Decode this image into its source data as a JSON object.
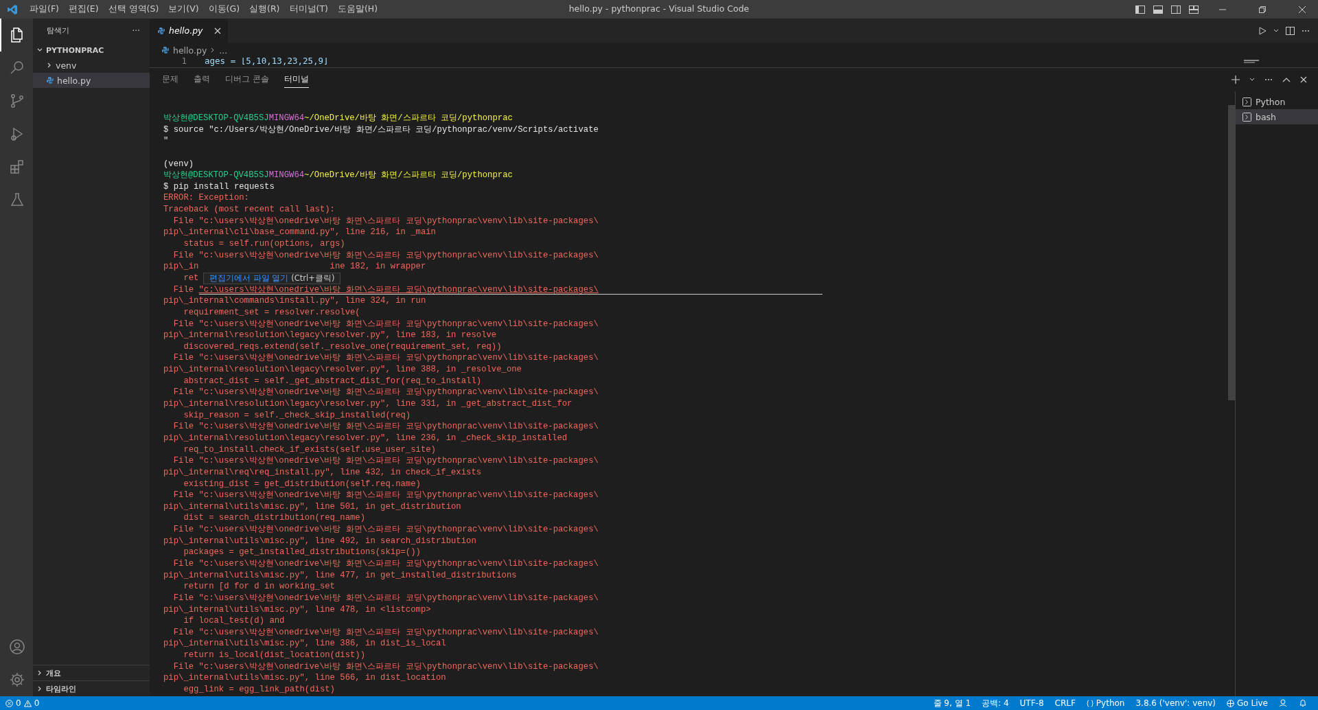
{
  "window": {
    "title": "hello.py - pythonprac - Visual Studio Code"
  },
  "menu": [
    "파일(F)",
    "편집(E)",
    "선택 영역(S)",
    "보기(V)",
    "이동(G)",
    "실행(R)",
    "터미널(T)",
    "도움말(H)"
  ],
  "activity_bar": [
    {
      "kind": "files",
      "selected": true
    },
    {
      "kind": "search",
      "selected": false
    },
    {
      "kind": "source-control",
      "selected": false
    },
    {
      "kind": "run",
      "selected": false
    },
    {
      "kind": "extensions",
      "selected": false
    },
    {
      "kind": "testing",
      "selected": false
    }
  ],
  "sidebar": {
    "title": "탐색기",
    "more": "···",
    "root": {
      "label": "PYTHONPRAC",
      "expanded": true,
      "children": [
        {
          "label": "venv",
          "kind": "folder",
          "expanded": false,
          "selected": false
        },
        {
          "label": "hello.py",
          "kind": "python",
          "selected": true
        }
      ]
    },
    "sections": [
      {
        "label": "개요",
        "expanded": false
      },
      {
        "label": "타임라인",
        "expanded": false
      }
    ]
  },
  "editor": {
    "tabs": [
      {
        "label": "hello.py",
        "selected": true
      }
    ],
    "breadcrumb": [
      "hello.py",
      "..."
    ],
    "lines": [
      {
        "number": "1",
        "code": "ages = [5,10,13,23,25,9]"
      }
    ]
  },
  "panel": {
    "tabs": [
      {
        "label": "문제",
        "selected": false
      },
      {
        "label": "출력",
        "selected": false
      },
      {
        "label": "디버그 콘솔",
        "selected": false
      },
      {
        "label": "터미널",
        "selected": true
      }
    ],
    "terminals": [
      {
        "label": "Python",
        "selected": false
      },
      {
        "label": "bash",
        "selected": true
      }
    ],
    "tooltip": {
      "text": "편집기에서 파일 열기",
      "shortcut": "(Ctrl+클릭)"
    },
    "lines": [
      {
        "kind": "prompt",
        "user": "박상현@DESKTOP-QV4B5SJ",
        "shell": "MINGW64",
        "path": "~/OneDrive/바탕 화면/스파르타 코딩/pythonprac"
      },
      {
        "kind": "command",
        "text": "$ source \"c:/Users/박상현/OneDrive/바탕 화면/스파르타 코딩/pythonprac/venv/Scripts/activate"
      },
      {
        "kind": "command",
        "text": "\""
      },
      {
        "kind": "blank"
      },
      {
        "kind": "command",
        "text": "(venv)"
      },
      {
        "kind": "prompt",
        "user": "박상현@DESKTOP-QV4B5SJ",
        "shell": "MINGW64",
        "path": "~/OneDrive/바탕 화면/스파르타 코딩/pythonprac"
      },
      {
        "kind": "command",
        "text": "$ pip install requests"
      },
      {
        "kind": "error",
        "text": "ERROR: Exception:"
      },
      {
        "kind": "error",
        "text": "Traceback (most recent call last):"
      },
      {
        "kind": "error",
        "text": "  File \"c:\\users\\박상현\\onedrive\\바탕 화면\\스파르타 코딩\\pythonprac\\venv\\lib\\site-packages\\"
      },
      {
        "kind": "error",
        "text": "pip\\_internal\\cli\\base_command.py\", line 216, in _main"
      },
      {
        "kind": "error",
        "text": "    status = self.run(options, args)"
      },
      {
        "kind": "error",
        "text": "  File \"c:\\users\\박상현\\onedrive\\바탕 화면\\스파르타 코딩\\pythonprac\\venv\\lib\\site-packages\\"
      },
      {
        "kind": "split",
        "parts": [
          "pip\\_in",
          "ine 182, in wrapper"
        ]
      },
      {
        "kind": "anchor",
        "text": "    ret"
      },
      {
        "kind": "link",
        "prefix": "  File ",
        "link": "\"c:\\users\\박상현\\onedrive\\바탕 화면\\스파르타 코딩\\pythonprac\\venv\\lib\\site-packages\\",
        "hovered": true
      },
      {
        "kind": "error",
        "text": "pip\\_internal\\commands\\install.py\", line 324, in run"
      },
      {
        "kind": "error",
        "text": "    requirement_set = resolver.resolve("
      },
      {
        "kind": "error",
        "text": "  File \"c:\\users\\박상현\\onedrive\\바탕 화면\\스파르타 코딩\\pythonprac\\venv\\lib\\site-packages\\"
      },
      {
        "kind": "error",
        "text": "pip\\_internal\\resolution\\legacy\\resolver.py\", line 183, in resolve"
      },
      {
        "kind": "error",
        "text": "    discovered_reqs.extend(self._resolve_one(requirement_set, req))"
      },
      {
        "kind": "error",
        "text": "  File \"c:\\users\\박상현\\onedrive\\바탕 화면\\스파르타 코딩\\pythonprac\\venv\\lib\\site-packages\\"
      },
      {
        "kind": "error",
        "text": "pip\\_internal\\resolution\\legacy\\resolver.py\", line 388, in _resolve_one"
      },
      {
        "kind": "error",
        "text": "    abstract_dist = self._get_abstract_dist_for(req_to_install)"
      },
      {
        "kind": "error",
        "text": "  File \"c:\\users\\박상현\\onedrive\\바탕 화면\\스파르타 코딩\\pythonprac\\venv\\lib\\site-packages\\"
      },
      {
        "kind": "error",
        "text": "pip\\_internal\\resolution\\legacy\\resolver.py\", line 331, in _get_abstract_dist_for"
      },
      {
        "kind": "error",
        "text": "    skip_reason = self._check_skip_installed(req)"
      },
      {
        "kind": "error",
        "text": "  File \"c:\\users\\박상현\\onedrive\\바탕 화면\\스파르타 코딩\\pythonprac\\venv\\lib\\site-packages\\"
      },
      {
        "kind": "error",
        "text": "pip\\_internal\\resolution\\legacy\\resolver.py\", line 236, in _check_skip_installed"
      },
      {
        "kind": "error",
        "text": "    req_to_install.check_if_exists(self.use_user_site)"
      },
      {
        "kind": "error",
        "text": "  File \"c:\\users\\박상현\\onedrive\\바탕 화면\\스파르타 코딩\\pythonprac\\venv\\lib\\site-packages\\"
      },
      {
        "kind": "error",
        "text": "pip\\_internal\\req\\req_install.py\", line 432, in check_if_exists"
      },
      {
        "kind": "error",
        "text": "    existing_dist = get_distribution(self.req.name)"
      },
      {
        "kind": "error",
        "text": "  File \"c:\\users\\박상현\\onedrive\\바탕 화면\\스파르타 코딩\\pythonprac\\venv\\lib\\site-packages\\"
      },
      {
        "kind": "error",
        "text": "pip\\_internal\\utils\\misc.py\", line 501, in get_distribution"
      },
      {
        "kind": "error",
        "text": "    dist = search_distribution(req_name)"
      },
      {
        "kind": "error",
        "text": "  File \"c:\\users\\박상현\\onedrive\\바탕 화면\\스파르타 코딩\\pythonprac\\venv\\lib\\site-packages\\"
      },
      {
        "kind": "error",
        "text": "pip\\_internal\\utils\\misc.py\", line 492, in search_distribution"
      },
      {
        "kind": "error",
        "text": "    packages = get_installed_distributions(skip=())"
      },
      {
        "kind": "error",
        "text": "  File \"c:\\users\\박상현\\onedrive\\바탕 화면\\스파르타 코딩\\pythonprac\\venv\\lib\\site-packages\\"
      },
      {
        "kind": "error",
        "text": "pip\\_internal\\utils\\misc.py\", line 477, in get_installed_distributions"
      },
      {
        "kind": "error",
        "text": "    return [d for d in working_set"
      },
      {
        "kind": "error",
        "text": "  File \"c:\\users\\박상현\\onedrive\\바탕 화면\\스파르타 코딩\\pythonprac\\venv\\lib\\site-packages\\"
      },
      {
        "kind": "error",
        "text": "pip\\_internal\\utils\\misc.py\", line 478, in <listcomp>"
      },
      {
        "kind": "error",
        "text": "    if local_test(d) and"
      },
      {
        "kind": "error",
        "text": "  File \"c:\\users\\박상현\\onedrive\\바탕 화면\\스파르타 코딩\\pythonprac\\venv\\lib\\site-packages\\"
      },
      {
        "kind": "error",
        "text": "pip\\_internal\\utils\\misc.py\", line 386, in dist_is_local"
      },
      {
        "kind": "error",
        "text": "    return is_local(dist_location(dist))"
      },
      {
        "kind": "error",
        "text": "  File \"c:\\users\\박상현\\onedrive\\바탕 화면\\스파르타 코딩\\pythonprac\\venv\\lib\\site-packages\\"
      },
      {
        "kind": "error",
        "text": "pip\\_internal\\utils\\misc.py\", line 566, in dist_location"
      },
      {
        "kind": "error",
        "text": "    egg_link = egg_link_path(dist)"
      }
    ]
  },
  "status_bar": {
    "errors": "0",
    "warnings": "0",
    "right": [
      {
        "kind": "text",
        "text": "줄 9, 열 1"
      },
      {
        "kind": "text",
        "text": "공백: 4"
      },
      {
        "kind": "text",
        "text": "UTF-8"
      },
      {
        "kind": "text",
        "text": "CRLF"
      },
      {
        "kind": "language",
        "text": "Python"
      },
      {
        "kind": "text",
        "text": "3.8.6 ('venv': venv)"
      },
      {
        "kind": "golive",
        "text": "Go Live"
      },
      {
        "kind": "feedback"
      },
      {
        "kind": "bell"
      }
    ]
  }
}
